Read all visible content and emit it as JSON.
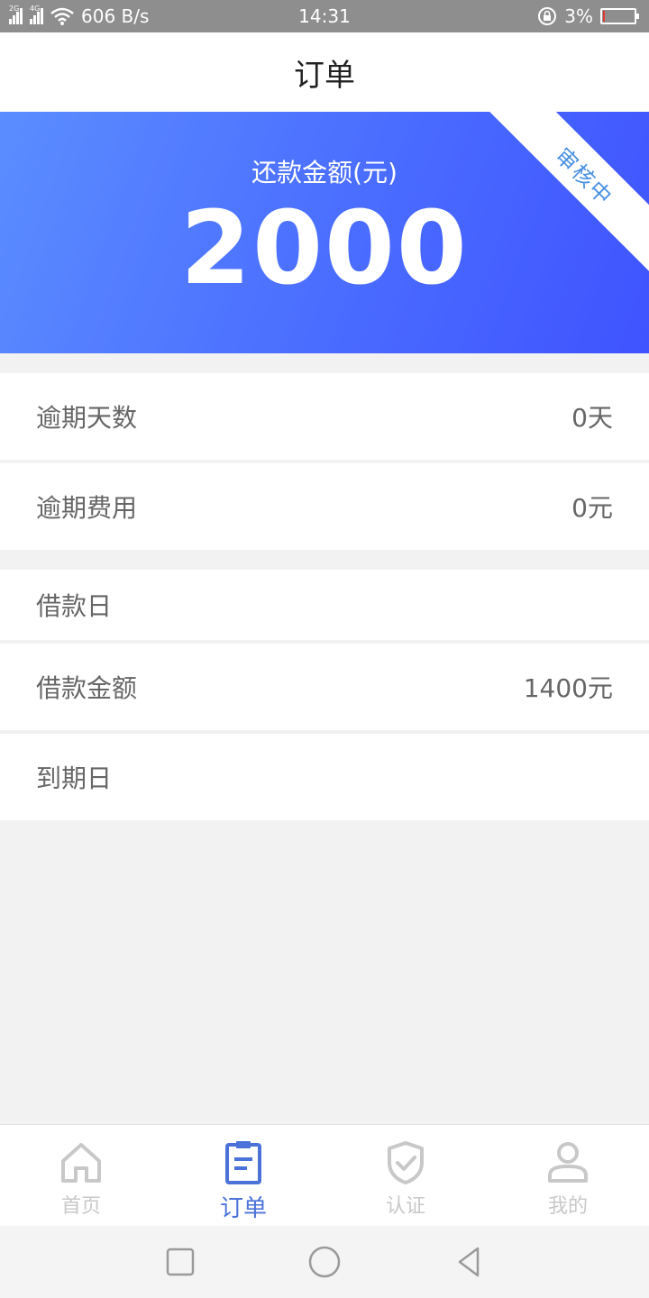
{
  "status_bar": {
    "net_2g": "2G",
    "net_4g": "4G",
    "speed": "606 B/s",
    "time": "14:31",
    "battery_text": "3%",
    "battery_level": 0.03
  },
  "header": {
    "title": "订单"
  },
  "hero": {
    "label": "还款金额(元)",
    "amount": "2000",
    "ribbon": "审核中",
    "colors": {
      "start": "#5b8dff",
      "end": "#3f53ff"
    }
  },
  "rows": [
    {
      "label": "逾期天数",
      "value": "0天"
    },
    {
      "label": "逾期费用",
      "value": "0元"
    },
    {
      "label": "借款日",
      "value": ""
    },
    {
      "label": "借款金额",
      "value": "1400元"
    },
    {
      "label": "到期日",
      "value": ""
    }
  ],
  "tabs": [
    {
      "label": "首页",
      "icon": "home-icon",
      "active": false
    },
    {
      "label": "订单",
      "icon": "order-icon",
      "active": true
    },
    {
      "label": "认证",
      "icon": "shield-check-icon",
      "active": false
    },
    {
      "label": "我的",
      "icon": "user-icon",
      "active": false
    }
  ],
  "colors": {
    "accent": "#4a72d9",
    "inactive": "#c8c8c8",
    "ribbon_text": "#4a90e2"
  }
}
